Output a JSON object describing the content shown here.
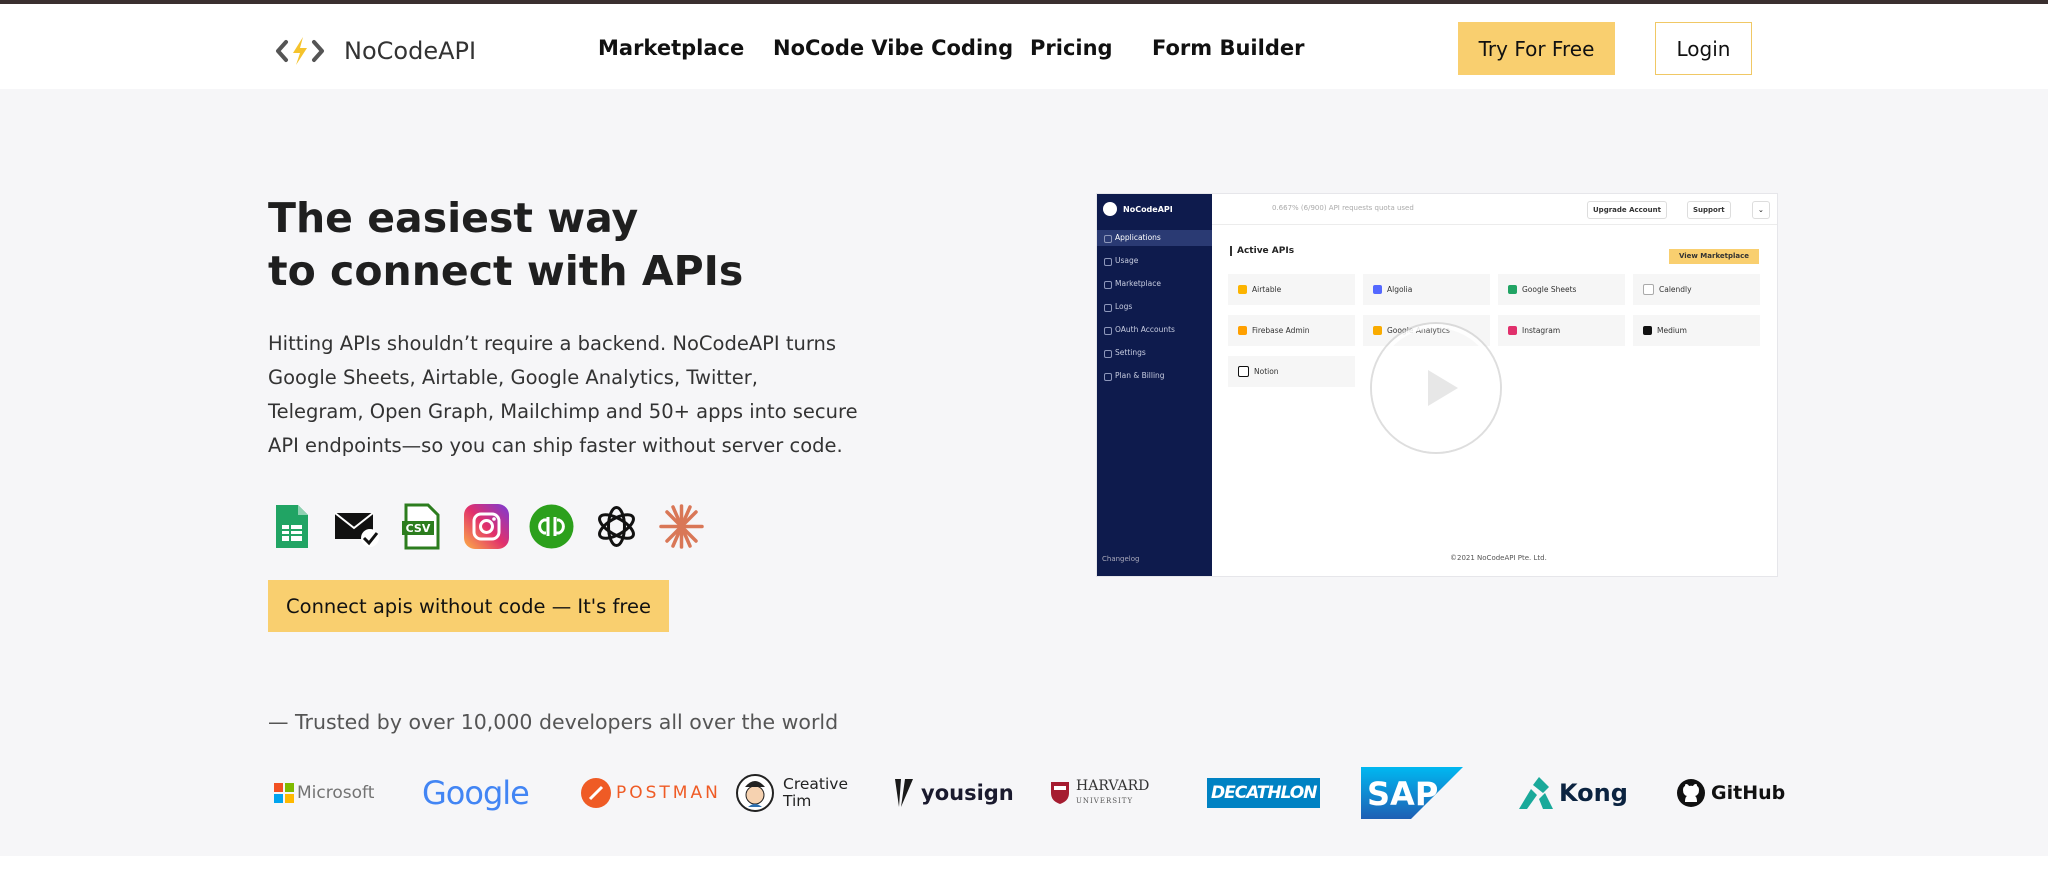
{
  "nav": {
    "brand": "NoCodeAPI",
    "links": [
      "Marketplace",
      "NoCode Vibe Coding",
      "Pricing",
      "Form Builder"
    ],
    "try_label": "Try For Free",
    "login_label": "Login"
  },
  "hero": {
    "title_line1": "The easiest way",
    "title_line2": "to connect with APIs",
    "description": "Hitting APIs shouldn’t require a backend. NoCodeAPI turns Google Sheets, Airtable, Google Analytics, Twitter, Telegram, Open Graph, Mailchimp and 50+ apps into secure API endpoints—so you can ship faster without server code.",
    "cta_label": "Connect apis without code — It's free",
    "icons": [
      "google-sheets-icon",
      "email-verify-icon",
      "csv-icon",
      "instagram-icon",
      "quickbooks-icon",
      "openai-icon",
      "claude-icon"
    ]
  },
  "video": {
    "app_name": "NoCodeAPI",
    "quota": "0.667% (6/900) API requests quota used",
    "upgrade_label": "Upgrade Account",
    "support_label": "Support",
    "sidebar": [
      "Applications",
      "Usage",
      "Marketplace",
      "Logs",
      "OAuth Accounts",
      "Settings",
      "Plan & Billing"
    ],
    "section_title": "Active APIs",
    "view_marketplace": "View Marketplace",
    "apis": [
      "Airtable",
      "Algolia",
      "Google Sheets",
      "Calendly",
      "Firebase Admin",
      "Google Analytics",
      "Instagram",
      "Medium",
      "Notion"
    ],
    "copyright": "©2021 NoCodeAPI Pte. Ltd.",
    "changelog": "Changelog"
  },
  "trusted": {
    "text": "— Trusted by over 10,000 developers all over the world",
    "brands": [
      "Microsoft",
      "Google",
      "POSTMAN",
      "Creative Tim",
      "yousign",
      "HARVARD",
      "DECATHLON",
      "SAP",
      "Kong",
      "GitHub"
    ],
    "harvard_sub": "UNIVERSITY",
    "creative_tim_line1": "Creative",
    "creative_tim_line2": "Tim"
  },
  "colors": {
    "accent": "#f9cf6f",
    "sidebar": "#0e1b4d",
    "background": "#f6f6f8"
  }
}
